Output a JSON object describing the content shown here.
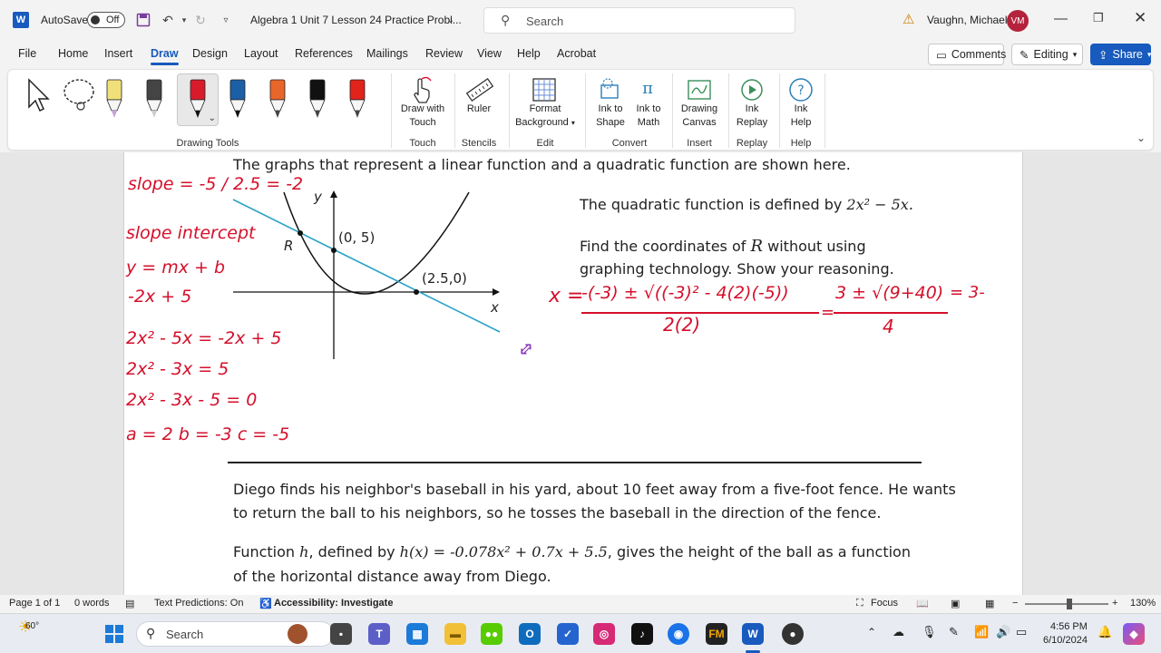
{
  "titlebar": {
    "autosave_label": "AutoSave",
    "toggle_state": "Off",
    "doc_title": "Algebra 1 Unit 7 Lesson 24 Practice Probl...",
    "search_placeholder": "Search",
    "user_name": "Vaughn, Michael",
    "user_initials": "VM"
  },
  "tabs": [
    "File",
    "Home",
    "Insert",
    "Draw",
    "Design",
    "Layout",
    "References",
    "Mailings",
    "Review",
    "View",
    "Help",
    "Acrobat"
  ],
  "active_tab": "Draw",
  "right_buttons": {
    "comments": "Comments",
    "editing": "Editing",
    "share": "Share"
  },
  "ribbon": {
    "groups": {
      "drawing_tools": "Drawing Tools",
      "touch": "Touch",
      "stencils": "Stencils",
      "edit": "Edit",
      "convert": "Convert",
      "insert": "Insert",
      "replay": "Replay",
      "help": "Help"
    },
    "items": {
      "draw_with_touch_1": "Draw with",
      "draw_with_touch_2": "Touch",
      "ruler": "Ruler",
      "format_bg_1": "Format",
      "format_bg_2": "Background",
      "ink_shape_1": "Ink to",
      "ink_shape_2": "Shape",
      "ink_math_1": "Ink to",
      "ink_math_2": "Math",
      "canvas_1": "Drawing",
      "canvas_2": "Canvas",
      "replay_1": "Ink",
      "replay_2": "Replay",
      "help_1": "Ink",
      "help_2": "Help"
    },
    "pens": [
      {
        "name": "highlighter-yellow",
        "color": "#f1e07a",
        "tip": "#c8a0d8"
      },
      {
        "name": "pencil-gray",
        "color": "#444444",
        "tip": "#cccccc"
      },
      {
        "name": "pen-red",
        "color": "#d81b2b",
        "tip": "#111111"
      },
      {
        "name": "pen-blue",
        "color": "#1b5fa6",
        "tip": "#111111"
      },
      {
        "name": "pen-orange",
        "color": "#e8662a",
        "tip": "#444444"
      },
      {
        "name": "pen-black",
        "color": "#111111",
        "tip": "#444444"
      },
      {
        "name": "pen-red-2",
        "color": "#e0231b",
        "tip": "#444444"
      }
    ]
  },
  "document": {
    "intro": "The graphs that represent a linear function and a quadratic function are shown here.",
    "quad_def_prefix": "The quadratic function is defined by",
    "quad_def_expr": "2x² − 5x.",
    "find_line1_a": "Find the coordinates of",
    "find_line1_var": "R",
    "find_line1_b": "without using",
    "find_line2": "graphing technology. Show your reasoning.",
    "graph": {
      "y_label": "y",
      "x_label": "x",
      "r_label": "R",
      "point_a": "(0, 5)",
      "point_b": "(2.5,0)"
    },
    "diego_line1": "Diego finds his neighbor's baseball in his yard, about 10 feet away from a five-foot fence. He wants",
    "diego_line2": "to return the ball to his neighbors, so he tosses the baseball in the direction of the fence.",
    "func_line1_a": "Function",
    "func_line1_var": "h",
    "func_line1_b": ", defined by",
    "func_line1_expr": "h(x) = -0.078x² + 0.7x + 5.5",
    "func_line1_c": ", gives the height of the ball as a function",
    "func_line2": "of the horizontal distance away from Diego."
  },
  "handwriting": {
    "slope": "slope = -5 / 2.5 = -2",
    "slope_intercept": "slope intercept",
    "ymxb": "y = mx + b",
    "line_eq": "-2x + 5",
    "eq1": "2x² - 5x = -2x + 5",
    "eq2": "2x² - 3x = 5",
    "eq3": "2x² - 3x - 5 = 0",
    "coeffs": "a = 2  b = -3  c = -5",
    "quad_x": "x =",
    "quad_num": "-(-3) ± √((-3)² - 4(2)(-5))",
    "quad_den": "2(2)",
    "quad_num2": "3 ± √(9+40)",
    "quad_den2": "4",
    "quad_tail": "= 3-"
  },
  "statusbar": {
    "page": "Page 1 of 1",
    "words": "0 words",
    "predictions": "Text Predictions: On",
    "accessibility": "Accessibility: Investigate",
    "focus": "Focus",
    "zoom": "130%"
  },
  "taskbar": {
    "weather": "60°",
    "search": "Search",
    "time": "4:56 PM",
    "date": "6/10/2024"
  }
}
